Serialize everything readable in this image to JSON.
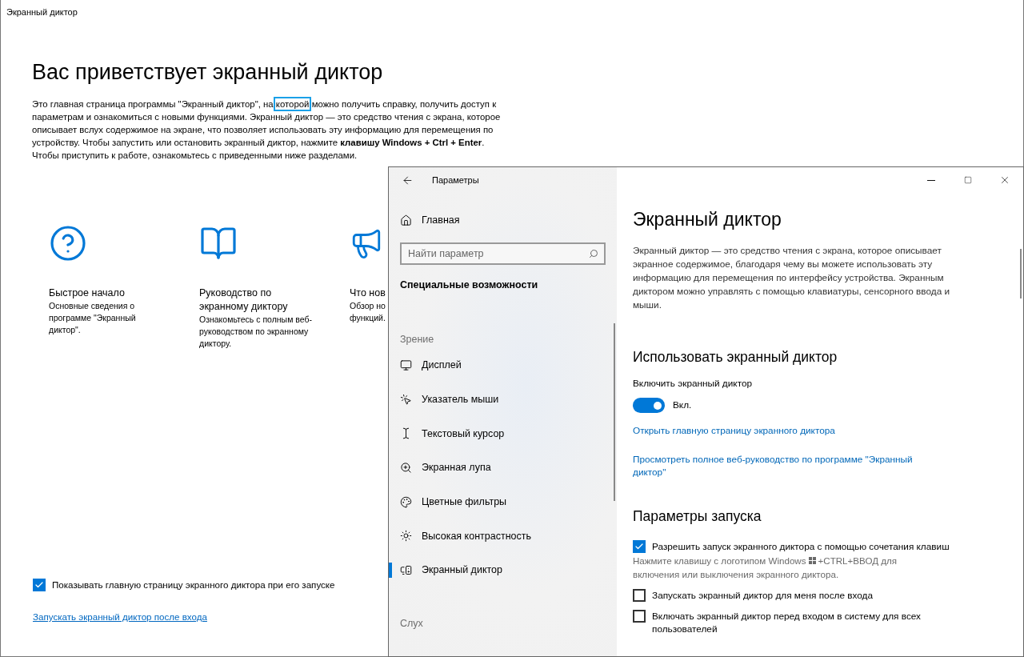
{
  "narrator_home": {
    "window_title": "Экранный диктор",
    "heading": "Вас приветствует экранный диктор",
    "intro": {
      "before": "Это главная страница программы \"Экранный диктор\", на ",
      "focused": "которой",
      "after": " можно получить справку, получить доступ к параметрам и ознакомиться с новыми функциями. Экранный диктор — это средство чтения с экрана, которое описывает вслух содержимое на экране, что позволяет использовать эту информацию для перемещения по устройству. Чтобы запустить или остановить экранный диктор, нажмите **клавишу Windows + Ctrl + Enter**. Чтобы приступить к работе, ознакомьтесь с приведенными ниже разделами."
    },
    "cards": [
      {
        "title": "Быстрое начало",
        "description": "Основные сведения о\nпрограмме \"Экранный\nдиктор\"."
      },
      {
        "title": "Руководство по\nэкранному диктору",
        "description": "Ознакомьтесь с полным веб-\nруководством по экранному\nдиктору."
      },
      {
        "title": "Что нов",
        "description": "Обзор но\nфункций."
      }
    ],
    "show_on_start": {
      "label": "Показывать главную страницу экранного диктора при его запуске",
      "checked": true
    },
    "link": "Запускать экранный диктор после входа"
  },
  "settings": {
    "window_title": "Параметры",
    "nav": {
      "home": "Главная",
      "search_placeholder": "Найти параметр",
      "section": "Специальные возможности",
      "groups": [
        {
          "heading": "Зрение",
          "items": [
            {
              "label": "Дисплей",
              "selected": false
            },
            {
              "label": "Указатель мыши",
              "selected": false
            },
            {
              "label": "Текстовый курсор",
              "selected": false
            },
            {
              "label": "Экранная лупа",
              "selected": false
            },
            {
              "label": "Цветные фильтры",
              "selected": false
            },
            {
              "label": "Высокая контрастность",
              "selected": false
            },
            {
              "label": "Экранный диктор",
              "selected": true
            }
          ]
        },
        {
          "heading": "Слух"
        }
      ]
    },
    "content": {
      "title": "Экранный диктор",
      "description": "Экранный диктор — это средство чтения с экрана, которое описывает экранное содержимое, благодаря чему вы можете использовать эту информацию для перемещения по интерфейсу устройства. Экранным диктором можно управлять с помощью клавиатуры, сенсорного ввода и мыши.",
      "use_section": {
        "heading": "Использовать экранный диктор",
        "toggle": {
          "label": "Включить экранный диктор",
          "on": true,
          "state_text": "Вкл."
        },
        "links": [
          "Открыть главную страницу экранного диктора",
          "Просмотреть полное веб-руководство по программе \"Экранный диктор\""
        ]
      },
      "startup_section": {
        "heading": "Параметры запуска",
        "options": [
          {
            "label": "Разрешить запуск экранного диктора с помощью сочетания клавиш",
            "checked": true,
            "hint_parts": [
              "Нажмите клавишу с логотипом Windows",
              "+CTRL+ВВОД для",
              "включения или выключения экранного диктора."
            ]
          },
          {
            "label": "Запускать экранный диктор для меня после входа",
            "checked": false
          },
          {
            "label": "Включать экранный диктор перед входом в систему для всех пользователей",
            "checked": false
          }
        ]
      }
    }
  }
}
